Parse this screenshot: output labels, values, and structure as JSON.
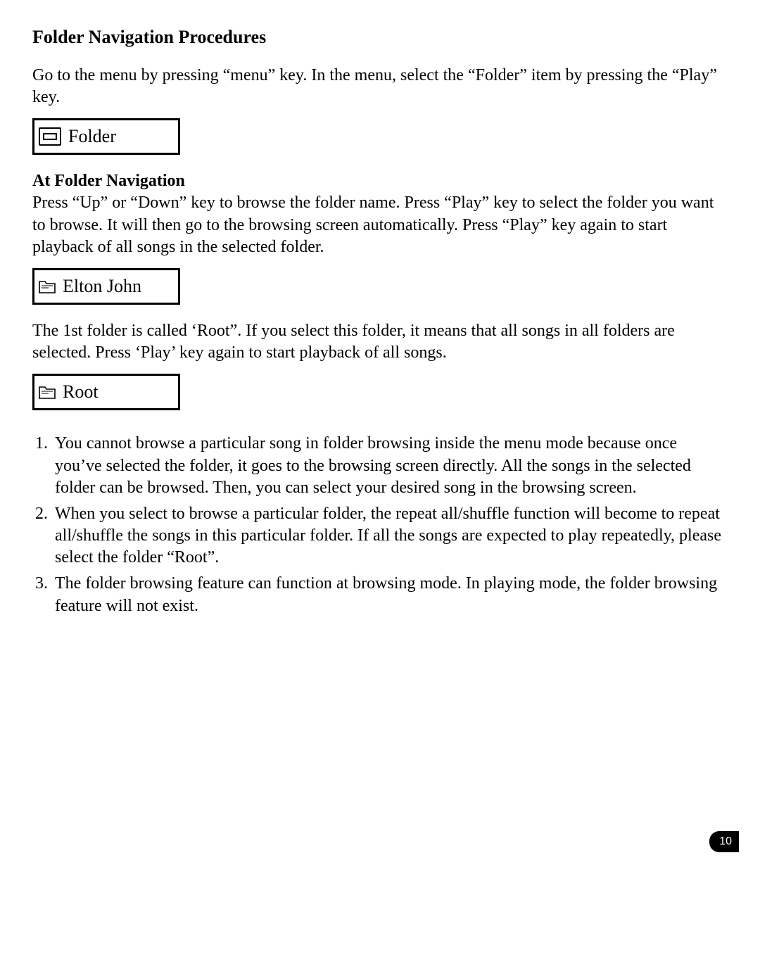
{
  "heading": "Folder Navigation Procedures",
  "intro": "Go to the menu by pressing “menu” key. In the menu, select the “Folder” item by pressing the “Play” key.",
  "lcd1_label": "Folder",
  "subheading": "At Folder Navigation",
  "para1": "Press “Up” or “Down” key to browse the folder name. Press “Play” key to select the folder you want to browse. It will then go to the browsing screen automatically. Press “Play” key again to start playback of all songs in the selected folder.",
  "lcd2_label": "Elton John",
  "para2": "The 1st folder is called ‘Root”.  If you select this folder, it means that all songs in all folders are selected. Press ‘Play’ key again to start playback of all songs.",
  "lcd3_label": "Root",
  "notes": [
    "You cannot browse a particular song in folder browsing inside the menu mode because once you’ve selected the folder, it goes to the browsing screen directly. All the songs in the selected folder can be browsed. Then, you can select your desired song in the browsing screen.",
    "When you select to browse a particular folder, the repeat all/shuffle function will become to repeat all/shuffle the songs in this particular folder. If all the songs are expected to play repeatedly, please select the folder “Root”.",
    "The folder browsing feature can function at browsing mode. In playing mode, the folder browsing feature will not exist."
  ],
  "page_number": "10"
}
